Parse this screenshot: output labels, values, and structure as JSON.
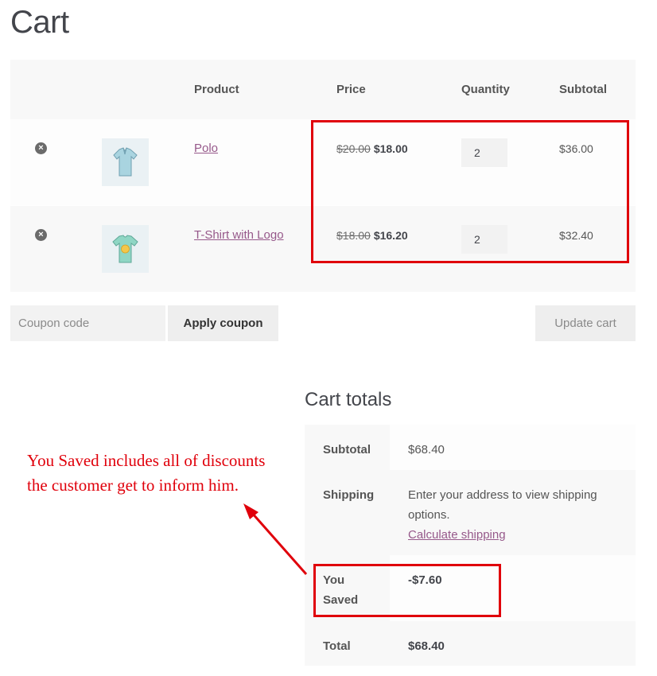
{
  "page": {
    "title": "Cart"
  },
  "cart": {
    "headers": {
      "product": "Product",
      "price": "Price",
      "quantity": "Quantity",
      "subtotal": "Subtotal"
    },
    "items": [
      {
        "name": "Polo",
        "old_price": "$20.00",
        "price": "$18.00",
        "quantity": "2",
        "subtotal": "$36.00",
        "remove_glyph": "×"
      },
      {
        "name": "T-Shirt with Logo",
        "old_price": "$18.00",
        "price": "$16.20",
        "quantity": "2",
        "subtotal": "$32.40",
        "remove_glyph": "×"
      }
    ]
  },
  "actions": {
    "coupon_placeholder": "Coupon code",
    "apply_coupon": "Apply coupon",
    "update_cart": "Update cart"
  },
  "totals": {
    "title": "Cart totals",
    "subtotal_label": "Subtotal",
    "subtotal_value": "$68.40",
    "shipping_label": "Shipping",
    "shipping_text": "Enter your address to view shipping options.",
    "calculate_shipping": "Calculate shipping",
    "saved_label": "You Saved",
    "saved_value": "-$7.60",
    "total_label": "Total",
    "total_value": "$68.40"
  },
  "annotation": {
    "note": "You Saved includes all of discounts the customer get to inform him.",
    "color": "#e0000b"
  },
  "colors": {
    "link": "#96588a",
    "text": "#43454b",
    "annotation": "#e0000b"
  }
}
